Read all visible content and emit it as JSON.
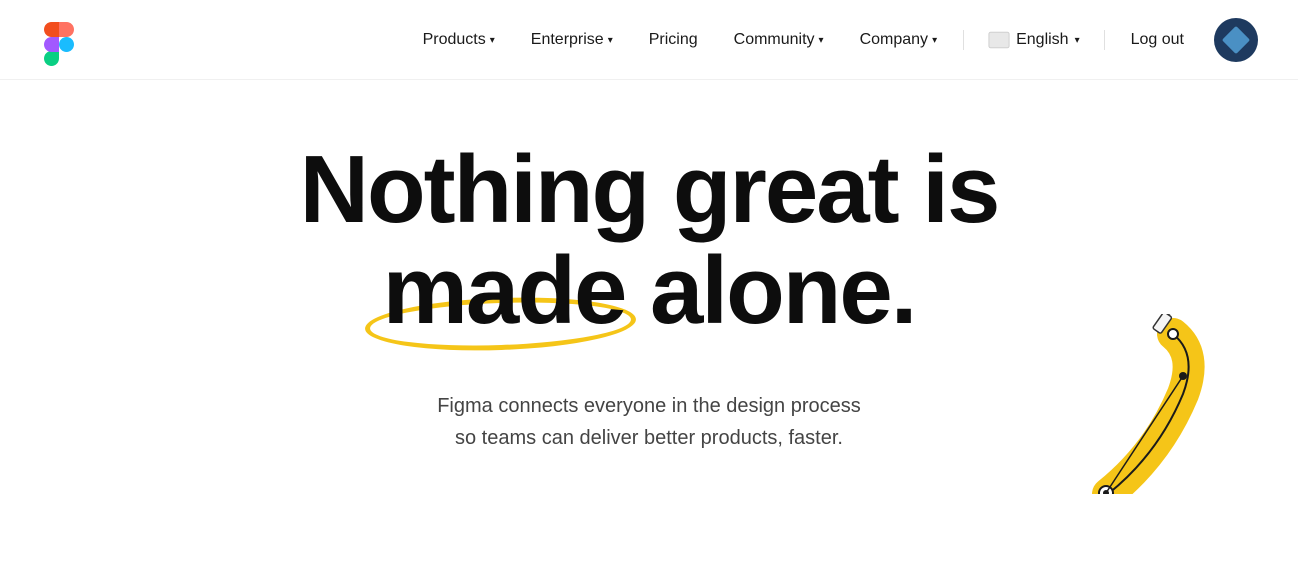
{
  "nav": {
    "logo_label": "Figma Logo",
    "links": [
      {
        "id": "products",
        "label": "Products",
        "has_dropdown": true
      },
      {
        "id": "enterprise",
        "label": "Enterprise",
        "has_dropdown": true
      },
      {
        "id": "pricing",
        "label": "Pricing",
        "has_dropdown": false
      },
      {
        "id": "community",
        "label": "Community",
        "has_dropdown": true
      },
      {
        "id": "company",
        "label": "Company",
        "has_dropdown": true
      }
    ],
    "lang_label": "English",
    "logout_label": "Log out"
  },
  "hero": {
    "line1": "Nothing great is",
    "line2_prefix": "",
    "made": "made",
    "line2_suffix": " alone.",
    "subtitle_line1": "Figma connects everyone in the design process",
    "subtitle_line2": "so teams can deliver better products, faster."
  }
}
